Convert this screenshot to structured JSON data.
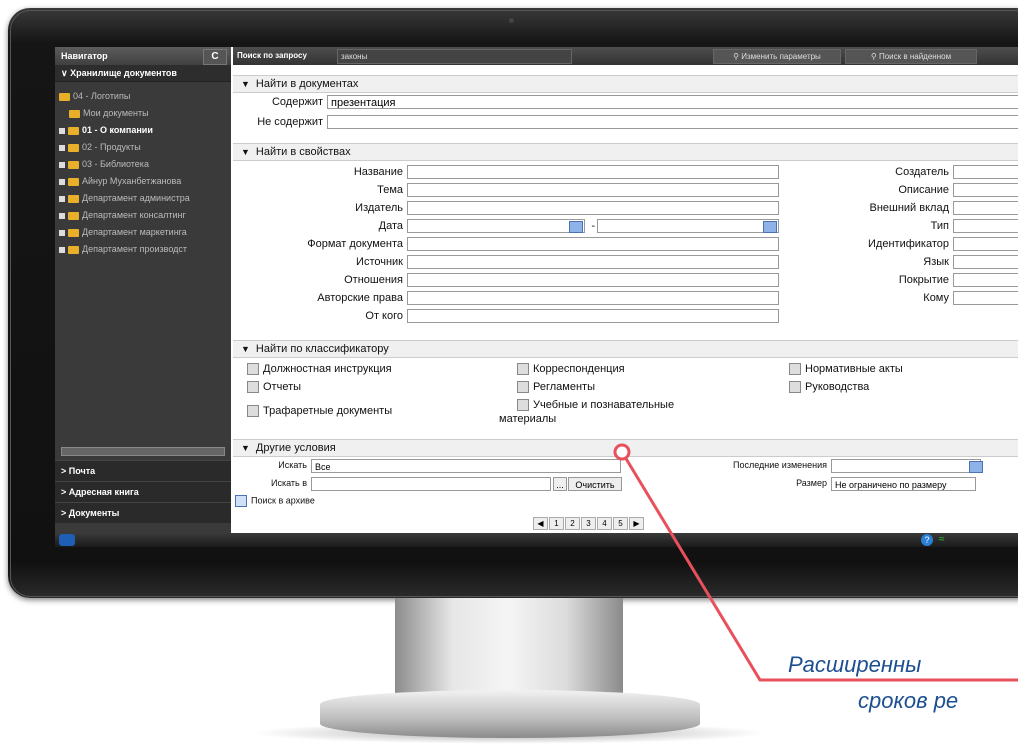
{
  "nav": {
    "title": "Навигатор",
    "refresh_icon": "refresh-icon",
    "storage": "Хранилище документов",
    "tree": [
      {
        "label": "04 - Логотипы",
        "bold": false,
        "expand": false
      },
      {
        "label": "Мои документы",
        "bold": false,
        "expand": false
      },
      {
        "label": "01 - О компании",
        "bold": true,
        "expand": true
      },
      {
        "label": "02 - Продукты",
        "bold": false,
        "expand": true
      },
      {
        "label": "03 - Библиотека",
        "bold": false,
        "expand": true
      },
      {
        "label": "Айнур Муханбетжанова",
        "bold": false,
        "expand": true
      },
      {
        "label": "Департамент администра",
        "bold": false,
        "expand": true
      },
      {
        "label": "Департамент консалтинг",
        "bold": false,
        "expand": true
      },
      {
        "label": "Департамент маркетинга",
        "bold": false,
        "expand": true
      },
      {
        "label": "Департамент производст",
        "bold": false,
        "expand": true
      }
    ],
    "bottom": [
      "Почта",
      "Адресная книга",
      "Документы"
    ]
  },
  "topbar": {
    "label": "Поиск по запросу",
    "query": "законы",
    "change_params": "Изменить параметры",
    "search_in_found": "Поиск в найденном"
  },
  "find_docs": {
    "title": "Найти в документах",
    "contains_label": "Содержит",
    "contains_value": "презентация",
    "not_contains_label": "Не содержит",
    "not_contains_value": ""
  },
  "props": {
    "title": "Найти в свойствах",
    "left": [
      "Название",
      "Тема",
      "Издатель",
      "Дата",
      "Формат документа",
      "Источник",
      "Отношения",
      "Авторские права",
      "От кого"
    ],
    "right": [
      "Создатель",
      "Описание",
      "Внешний вклад",
      "Тип",
      "Идентификатор",
      "Язык",
      "Покрытие",
      "Кому"
    ],
    "date_sep": "-"
  },
  "classifier": {
    "title": "Найти по классификатору",
    "items": [
      "Должностная инструкция",
      "Корреспонденция",
      "Нормативные акты",
      "Отчеты",
      "Регламенты",
      "Руководства",
      "Трафаретные документы",
      "Учебные и познавательные",
      "материалы"
    ]
  },
  "other": {
    "title": "Другие условия",
    "search_label": "Искать",
    "search_value": "Все",
    "search_in_label": "Искать в",
    "browse": "...",
    "clear": "Очистить",
    "archive": "Поиск в архиве",
    "last_changes": "Последние изменения",
    "size_label": "Размер",
    "size_value": "Не ограничено по размеру"
  },
  "pager": {
    "pages": [
      "1",
      "2",
      "3",
      "4",
      "5"
    ]
  },
  "annotation": {
    "line1": "Расширенны",
    "line2": "сроков ре",
    "color": "#e8505b"
  }
}
